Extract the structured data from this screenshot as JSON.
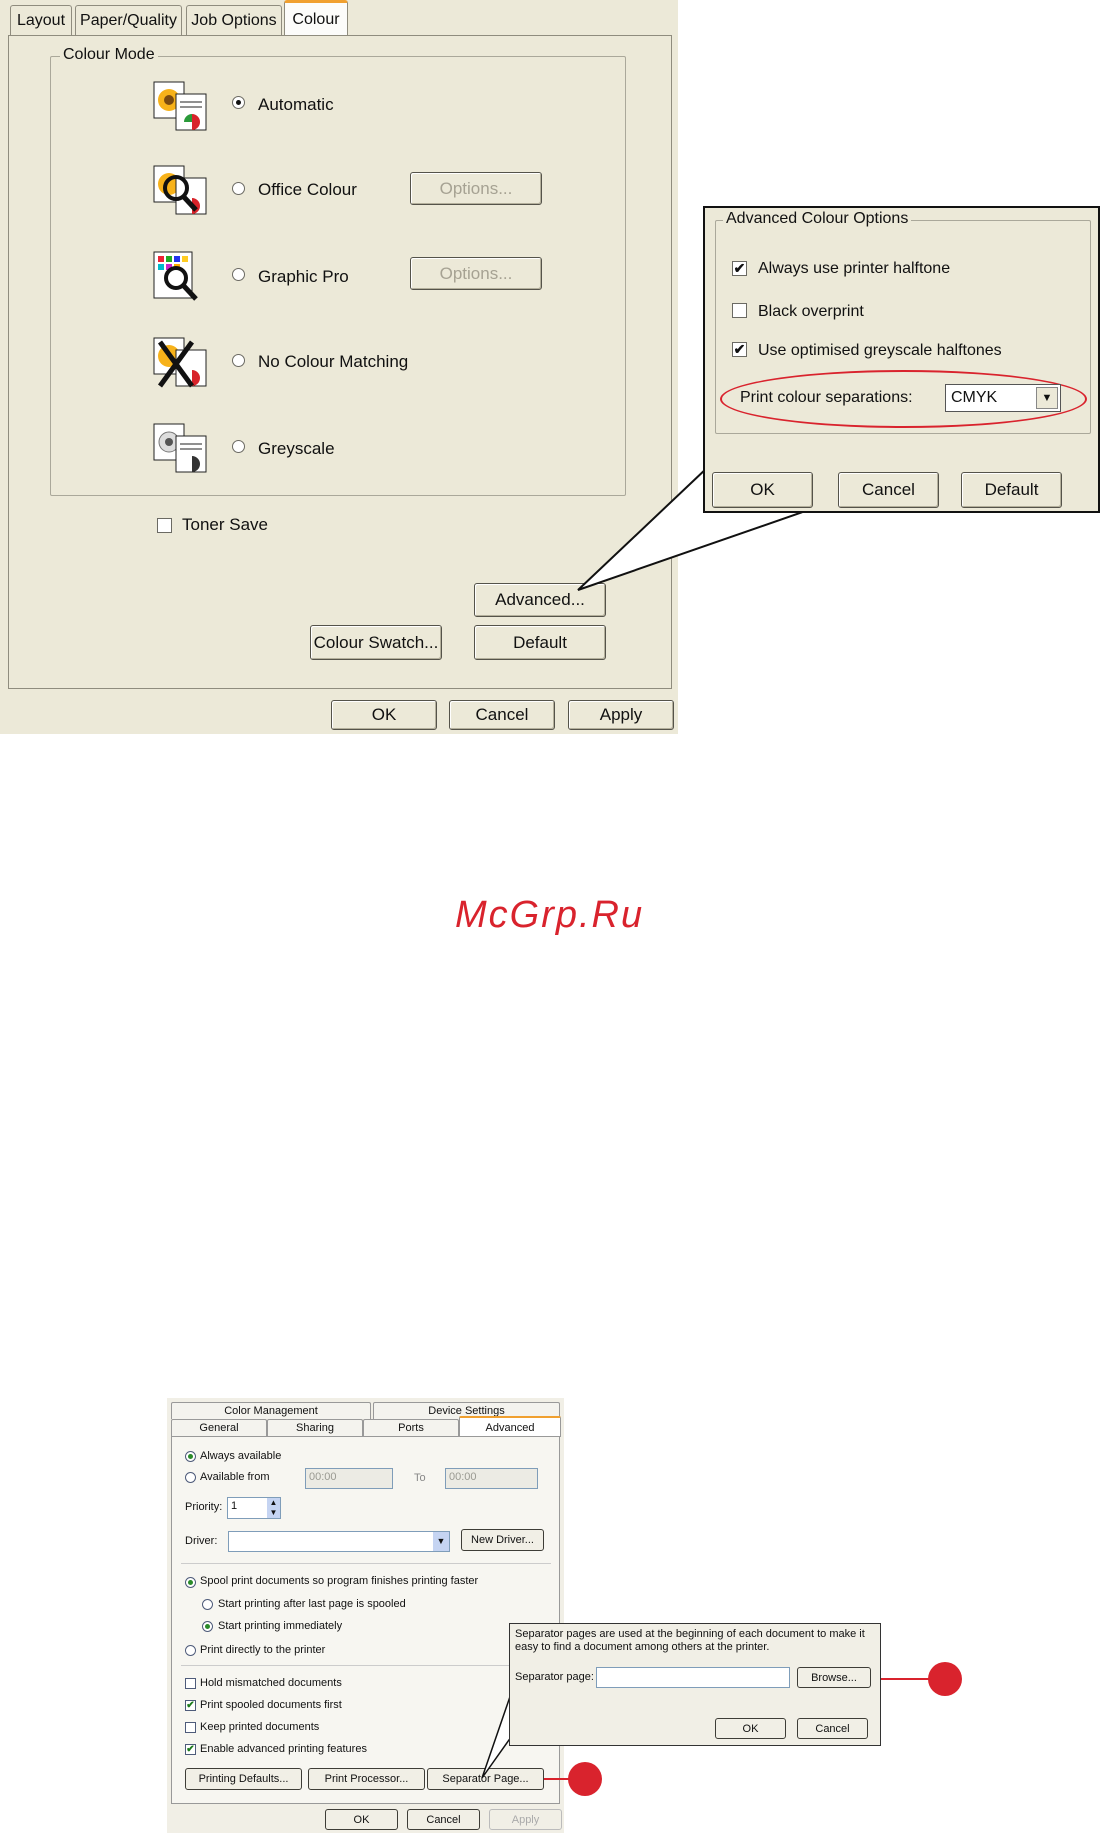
{
  "colour_dialog": {
    "tabs": [
      "Layout",
      "Paper/Quality",
      "Job Options",
      "Colour"
    ],
    "group_title": "Colour Mode",
    "modes": [
      {
        "label": "Automatic",
        "selected": true,
        "icon": "auto-colour-icon"
      },
      {
        "label": "Office Colour",
        "selected": false,
        "icon": "office-colour-icon",
        "options": "Options..."
      },
      {
        "label": "Graphic Pro",
        "selected": false,
        "icon": "graphic-pro-icon",
        "options": "Options..."
      },
      {
        "label": "No Colour Matching",
        "selected": false,
        "icon": "no-colour-matching-icon"
      },
      {
        "label": "Greyscale",
        "selected": false,
        "icon": "greyscale-icon"
      }
    ],
    "toner_save": "Toner Save",
    "advanced": "Advanced...",
    "colour_swatch": "Colour Swatch...",
    "default": "Default",
    "ok": "OK",
    "cancel": "Cancel",
    "apply": "Apply"
  },
  "advanced_popup": {
    "title": "Advanced Colour Options",
    "options": [
      {
        "label": "Always use printer halftone",
        "checked": true
      },
      {
        "label": "Black overprint",
        "checked": false
      },
      {
        "label": "Use optimised greyscale halftones",
        "checked": true
      }
    ],
    "separations_label": "Print colour separations:",
    "separations_value": "CMYK",
    "ok": "OK",
    "cancel": "Cancel",
    "default": "Default",
    "highlight_color": "#d9232d"
  },
  "watermark": "McGrp.Ru",
  "printer_dialog": {
    "tabs_row1": [
      "Color Management",
      "Device Settings"
    ],
    "tabs_row2": [
      "General",
      "Sharing",
      "Ports",
      "Advanced"
    ],
    "always_available": "Always available",
    "available_from": "Available from",
    "from_time": "00:00",
    "to_label": "To",
    "to_time": "00:00",
    "priority_label": "Priority:",
    "priority_value": "1",
    "driver_label": "Driver:",
    "driver_value": "",
    "new_driver": "New Driver...",
    "spool": "Spool print documents so program finishes printing faster",
    "start_after_last": "Start printing after last page is spooled",
    "start_immediately": "Start printing immediately",
    "print_directly": "Print directly to the printer",
    "hold_mismatched": "Hold mismatched documents",
    "print_spooled_first": "Print spooled documents first",
    "keep_printed": "Keep printed documents",
    "enable_advanced": "Enable advanced printing features",
    "printing_defaults": "Printing Defaults...",
    "print_processor": "Print Processor...",
    "separator_page": "Separator Page...",
    "ok": "OK",
    "cancel": "Cancel",
    "apply": "Apply"
  },
  "separator_popup": {
    "description": "Separator pages are used at the beginning of each document to make it easy to find a document among others at the printer.",
    "label": "Separator page:",
    "value": "",
    "browse": "Browse...",
    "ok": "OK",
    "cancel": "Cancel"
  },
  "callout_color": "#d9232d"
}
